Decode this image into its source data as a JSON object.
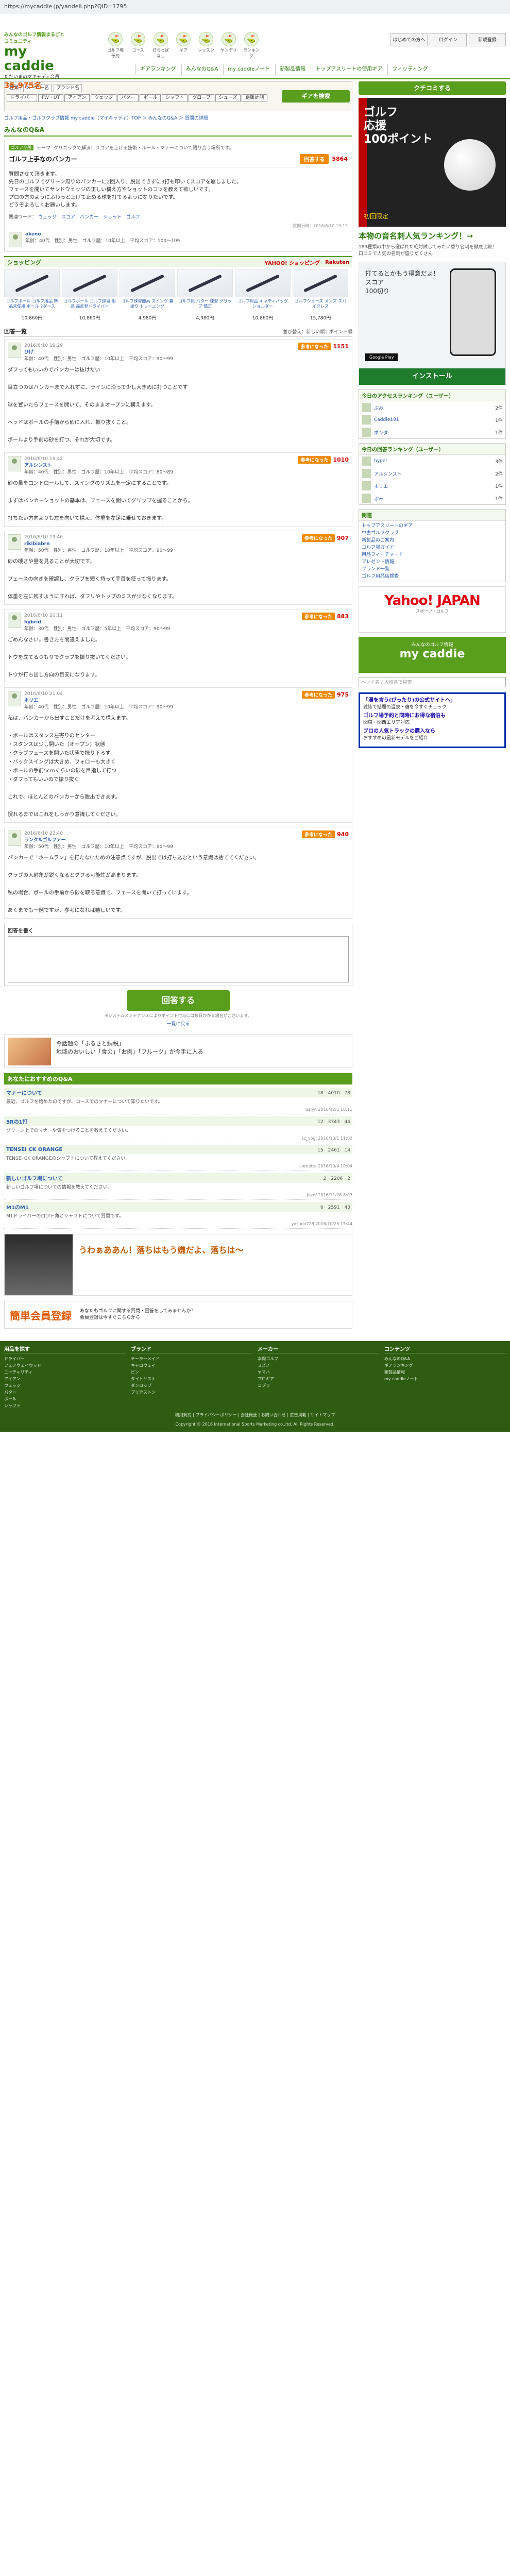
{
  "browser": {
    "url": "https://mycaddie.jp/yandeli.php?QID=1795"
  },
  "header": {
    "tagline": "みんなのゴルフ情報まるごとコミュニティ",
    "brand": "my caddie",
    "members_label": "ただいまのマキャディ会員",
    "members_count": "35,975名",
    "icons": [
      "ゴルフ場予約",
      "コース",
      "打ちっぱなし",
      "ギア",
      "レッスン",
      "ヤンデリ",
      "ランキング"
    ],
    "top_links": [
      "はじめての方へ",
      "ログイン",
      "新規登録"
    ],
    "nav": [
      "ギアランキング",
      "みんなのQ&A",
      "my caddieノート",
      "新製品情報",
      "トップアスリートの使用ギア",
      "フィッティング"
    ]
  },
  "search": {
    "select_kind": "種類",
    "select_maker": "メーカー名",
    "select_brand": "ブランド名",
    "chips": [
      "ドライバー",
      "FW・UT",
      "アイアン",
      "ウェッジ",
      "パター",
      "ボール",
      "シャフト",
      "グローブ",
      "シューズ",
      "距離計測"
    ],
    "button": "ギアを検索"
  },
  "breadcrumb": "ゴルフ用品・ゴルフクラブ情報 my caddie（マイキャディ）TOP ＞ みんなのQ&A ＞ 質問の詳細",
  "question": {
    "section": "みんなのQ&A",
    "category": "ゴルフ全般",
    "head_tag": "テーマ",
    "head_text": "クリニックで解決！スコアを上げる技術・ルール・マナーについて語り合う場所です。",
    "title": "ゴルフ上手なのバンカー",
    "answer_btn": "回答する",
    "count": "5864",
    "body": "質問させて頂きます。\n先日のゴルフでグリーン周りのバンカーに2回入り、脱出できずに3打も叩いてスコアを崩しました。\nフェースを開いてサンドウェッジの正しい構え方やショットのコツを教えて欲しいです。\nプロの方のようにふわっと上げて止める球を打てるようになりたいです。\nどうぞよろしくお願いします。",
    "tags_label": "関連ワード：",
    "tags": [
      "ウェッジ",
      "スコア",
      "バンカー",
      "ショット",
      "ゴルフ"
    ],
    "user": "akeno",
    "user_info": "年齢：40代　性別：男性　ゴルフ歴：10年以上　平均スコア：100〜109",
    "date": "質問日時：2016/6/10 19:19"
  },
  "shopping": {
    "title": "ショッピング",
    "yahoo": "YAHOO! ショッピング",
    "rakuten": "Rakuten",
    "items": [
      {
        "name": "ゴルフボール ゴルフ用品 新品未使用 ボール 2ダース",
        "price": "10,860円"
      },
      {
        "name": "ゴルフボール ゴルフ練習 用品 高反発ドライバー",
        "price": "10,860円"
      },
      {
        "name": "ゴルフ練習器具 スイング 素振り トレーニング",
        "price": "4,980円"
      },
      {
        "name": "ゴルフ用 パター 練習 グリップ 矯正",
        "price": "4,980円"
      },
      {
        "name": "ゴルフ用品 キャディバッグ ショルダー",
        "price": "10,860円"
      },
      {
        "name": "ゴルフシューズ メンズ スパイクレス",
        "price": "15,780円"
      }
    ]
  },
  "answers_section": {
    "title": "回答一覧",
    "sort": "並び替え：新しい順 | ポイント順"
  },
  "answers": [
    {
      "name": "ひげ",
      "info": "年齢：40代　性別：男性　ゴルフ歴：10年以上　平均スコア：90〜99",
      "date": "2016/6/10 19:29",
      "good": "1151",
      "good_btn": "参考になった",
      "body": "ダフってもいいのでバンカーは抜けたい\n\n目立つのはバンカーまで入れずに、ラインに沿って少し大きめに打つことです\n\n球を置いたらフェースを開いて、そのままオープンに構えます。\n\nヘッドはボールの手前から砂に入れ、振り抜くこと。\n\nボールより手前の砂を打つ、それが大切です。"
    },
    {
      "name": "アルシンスト",
      "info": "年齢：40代　性別：男性　ゴルフ歴：10年以上　平均スコア：80〜89",
      "date": "2016/6/10 19:42",
      "good": "1010",
      "good_btn": "参考になった",
      "body": "砂の量をコントロールして、スイングのリズムを一定にすることです。\n\nまずはバンカーショットの基本は、フェースを開いてグリップを握ることから。\n\n打ちたい方向よりも左を向いて構え、体重を左足に乗せておきます。"
    },
    {
      "name": "rikibiabrn",
      "info": "年齢：50代　性別：男性　ゴルフ歴：10年以上　平均スコア：90〜99",
      "date": "2016/6/10 19:46",
      "good": "907",
      "good_btn": "参考になった",
      "body": "砂の硬さや量を見ることが大切です。\n\nフェースの向きを確認し、クラブを短く持って手首を使って振ります。\n\n体重を左に残すようにすれば、ダフリやトップのミスが少なくなります。"
    },
    {
      "name": "hybrid",
      "info": "年齢：30代　性別：男性　ゴルフ歴：5年以上　平均スコア：90〜99",
      "date": "2016/6/10 20:11",
      "good": "883",
      "good_btn": "参考になった",
      "body": "ごめんなさい。書き方を間違えました。\n\nトウを立てるつもりでクラブを振り抜いてください。\n\nトウが打ち出し方向の目安になります。"
    },
    {
      "name": "ホリエ",
      "info": "年齢：40代　性別：男性　ゴルフ歴：10年以上　平均スコア：90〜99",
      "date": "2016/6/10 21:04",
      "good": "975",
      "good_btn": "参考になった",
      "body": "私は、バンカーから出すことだけを考えて構えます。\n\n・ボールはスタンス左寄りのセンター\n・スタンスは少し開いた（オープン）状態\n・クラブフェースを開いた状態で振り下ろす\n・バックスイングは大きめ、フォローも大きく\n・ボールの手前5cmくらいの砂を目指して打つ\n・ダフってもいいので振り抜く\n\nこれで、ほとんどのバンカーから脱出できます。\n\n慣れるまではこれをしっかり意識してください。"
    },
    {
      "name": "ランクルゴルファー",
      "info": "年齢：50代　性別：男性　ゴルフ歴：10年以上　平均スコア：90〜99",
      "date": "2016/6/10 22:40",
      "good": "940",
      "good_btn": "参考になった",
      "body": "バンカーで「ホームラン」を打たないための注意点ですが、脱出では打ち込むという意識は捨ててください。\n\nクラブの入射角が鋭くなるとダフる可能性が高まります。\n\n私の場合、ボールの手前から砂を取る意識で、フェースを開いて打っています。\n\nあくまでも一例ですが、参考になれば嬉しいです。"
    }
  ],
  "post_form": {
    "label": "回答を書く",
    "button": "回答する",
    "note": "※システムメンテナンスによりポイント付与には数日かかる場合がございます。",
    "back": "一覧に戻る"
  },
  "furusato": {
    "text": "今話題の「ふるさと納税」\n地域のおいしい「食の」「お肉」「フルーツ」が今手に入る"
  },
  "related": {
    "title": "あなたにおすすめのQ&A",
    "items": [
      {
        "title": "マナーについて",
        "stats": "18　4010　78",
        "body": "最近、ゴルフを始めたのですが、コースでのマナーについて知りたいです。",
        "foot": "Salyn 2016/12/5 10:11"
      },
      {
        "title": "5Rの1打",
        "stats": "12　3343　44",
        "body": "グリーン上でのマナーや気をつけることを教えてください。",
        "foot": "sc_yogi 2016/10/1 11:02"
      },
      {
        "title": "TENSEI CK ORANGE",
        "stats": "15　2461　14",
        "body": "TENSEI CK ORANGEのシャフトについて教えてください。",
        "foot": "cornette 2016/10/4 10:04"
      },
      {
        "title": "新しいゴルフ場について",
        "stats": "2　2206　2",
        "body": "新しいゴルフ場についての情報を教えてください。",
        "foot": "Jozef 2016/11/26 8:03"
      },
      {
        "title": "M1のM1",
        "stats": "6　2591　43",
        "body": "M1ドライバーのロフト角とシャフトについて質問です。",
        "foot": "yasuda728 2016/10/25 15:44"
      }
    ]
  },
  "banner_bottom": {
    "text": "うわぁああん！落ちはもう嫌だよ、落ちは〜"
  },
  "signup": {
    "big": "簡単会員登録",
    "small": "あなたもゴルフに関する質問・回答をしてみませんか？\n会員登録は今すぐこちらから"
  },
  "side": {
    "green_btn": "クチコミする",
    "ad_lines": "ゴルフ\n応援\n100ポイント",
    "ad_bottom": "初回限定",
    "title": "本物の音名刺人気ランキング！→",
    "text": "183種類の中から選ばれた絶対試してみたい香り名刺を徹底比較！\n口コミで人気の名刺が盛りだくさん",
    "phone_msg": "打てるとかもう得意だよ！\nスコア\n100切り",
    "store": "Google Play",
    "install": "インストール",
    "users_title": "今日のアクセスランキング（ユーザー）",
    "users": [
      {
        "name": "ぷみ",
        "count": "2件"
      },
      {
        "name": "Caddie101",
        "count": "1件"
      },
      {
        "name": "ホンダ",
        "count": "1件"
      }
    ],
    "users_title2": "今日の回答ランキング（ユーザー）",
    "users2": [
      {
        "name": "hyper",
        "count": "3件"
      },
      {
        "name": "アルシンスト",
        "count": "2件"
      },
      {
        "name": "ホリエ",
        "count": "1件"
      },
      {
        "name": "ぷみ",
        "count": "1件"
      }
    ],
    "links_title": "関連",
    "links": [
      "トップアスリートのギア",
      "中古ゴルフクラブ",
      "新製品のご案内",
      "ゴルフ場ガイド",
      "用品フィーチャード",
      "プレゼント情報",
      "ブランド一覧",
      "ゴルフ用品店検索"
    ],
    "yahoo": "Yahoo! JAPAN",
    "yahoo_sub": "スポーツ・ゴルフ",
    "mc_small": "みんなのゴルフ情報",
    "mc_big": "my caddie",
    "side_search": "ヘッド名 / 人物名で検索",
    "blue_ads": [
      {
        "link": "「湯を言う(ぴったり)の公式サイトへ」",
        "desc": "雑誌で話題の温泉・宿を今すぐチェック"
      },
      {
        "link": "ゴルフ場予約と同時にお得な宿泊も",
        "desc": "関東・関西エリア対応"
      },
      {
        "link": "プロの人気トラックの購入なら",
        "desc": "おすすめの最新モデルをご紹介"
      }
    ]
  },
  "footer": {
    "cols": [
      {
        "head": "用品を探す",
        "items": [
          "ドライバー",
          "フェアウェイウッド",
          "ユーティリティ",
          "アイアン",
          "ウェッジ",
          "パター",
          "ボール",
          "シャフト"
        ]
      },
      {
        "head": "ブランド",
        "items": [
          "テーラーメイド",
          "キャロウェイ",
          "ピン",
          "タイトリスト",
          "ダンロップ",
          "ブリヂストン"
        ]
      },
      {
        "head": "メーカー",
        "items": [
          "本間ゴルフ",
          "ミズノ",
          "ヤマハ",
          "プロギア",
          "コブラ"
        ]
      },
      {
        "head": "コンテンツ",
        "items": [
          "みんなのQ&A",
          "ギアランキング",
          "新製品情報",
          "my caddieノート"
        ]
      }
    ],
    "links": "利用規約 | プライバシーポリシー | 会社概要 | お問い合わせ | 広告掲載 | サイトマップ",
    "copyright": "Copyright © 2016 International Sports Marketing co.,ltd. All Rights Reserved."
  }
}
